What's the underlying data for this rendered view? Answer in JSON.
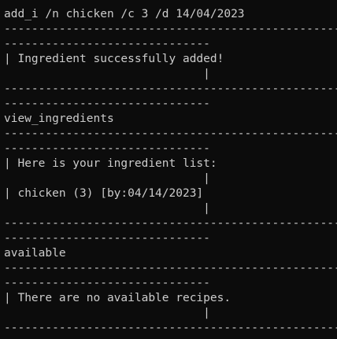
{
  "terminal": {
    "colors": {
      "background": "#0c0c0c",
      "foreground": "#cccccc"
    },
    "lines": [
      "------------------------------",
      "add_i /n chicken /c 3 /d 14/04/2023",
      "------------------------------------------------------------",
      "------------------------------",
      "| Ingredient successfully added!",
      "                             |",
      "------------------------------------------------------------",
      "------------------------------",
      "view_ingredients",
      "------------------------------------------------------------",
      "------------------------------",
      "| Here is your ingredient list:",
      "                             |",
      "| chicken (3) [by:04/14/2023]",
      "                             |",
      "------------------------------------------------------------",
      "------------------------------",
      "available",
      "------------------------------------------------------------",
      "------------------------------",
      "| There are no available recipes.",
      "                             |",
      "------------------------------------------------------------"
    ]
  }
}
